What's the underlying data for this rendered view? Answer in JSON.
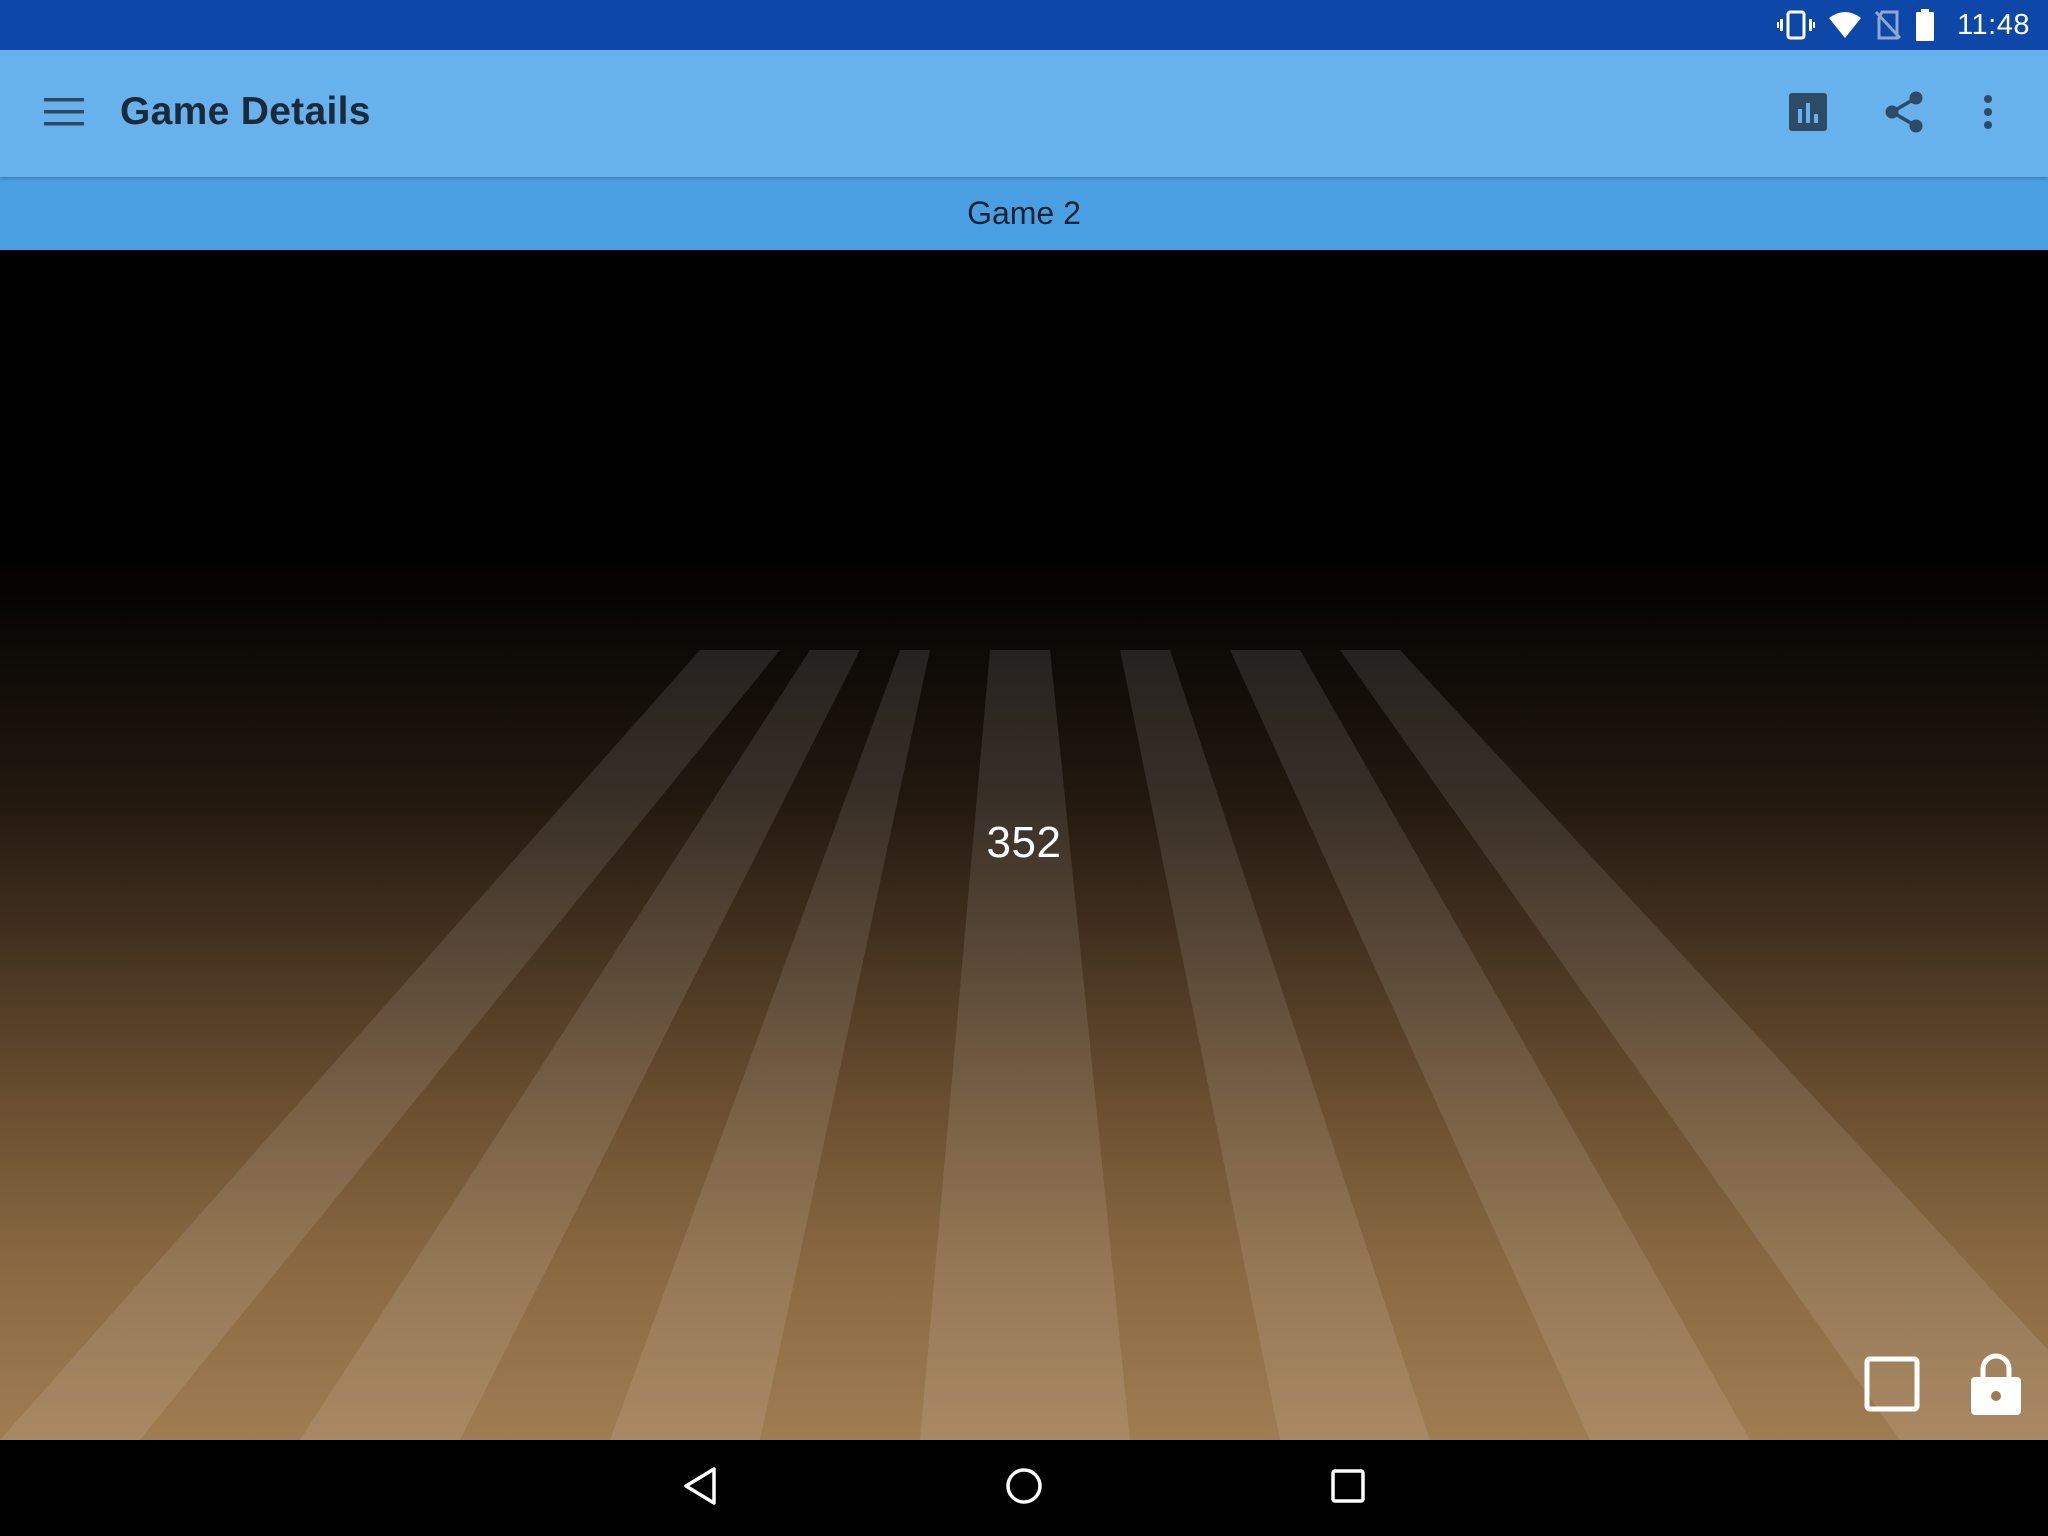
{
  "status_bar": {
    "time": "11:48",
    "icons": [
      "vibrate-icon",
      "wifi-icon",
      "no-sim-icon",
      "battery-icon"
    ]
  },
  "app_bar": {
    "title": "Game Details",
    "actions": [
      "stats-icon",
      "share-icon",
      "more-vert-icon"
    ],
    "color": "#67b1ec"
  },
  "sub_header": {
    "label": "Game 2",
    "color": "#4a9fe3"
  },
  "game": {
    "score": "352",
    "controls": [
      "square-outline-icon",
      "lock-icon"
    ]
  },
  "nav_bar": {
    "buttons": [
      "back-icon",
      "home-icon",
      "recents-icon"
    ]
  },
  "colors": {
    "status_bar": "#0d47a7",
    "lane_dark": "#000000",
    "lane_light": "#a07c52"
  }
}
